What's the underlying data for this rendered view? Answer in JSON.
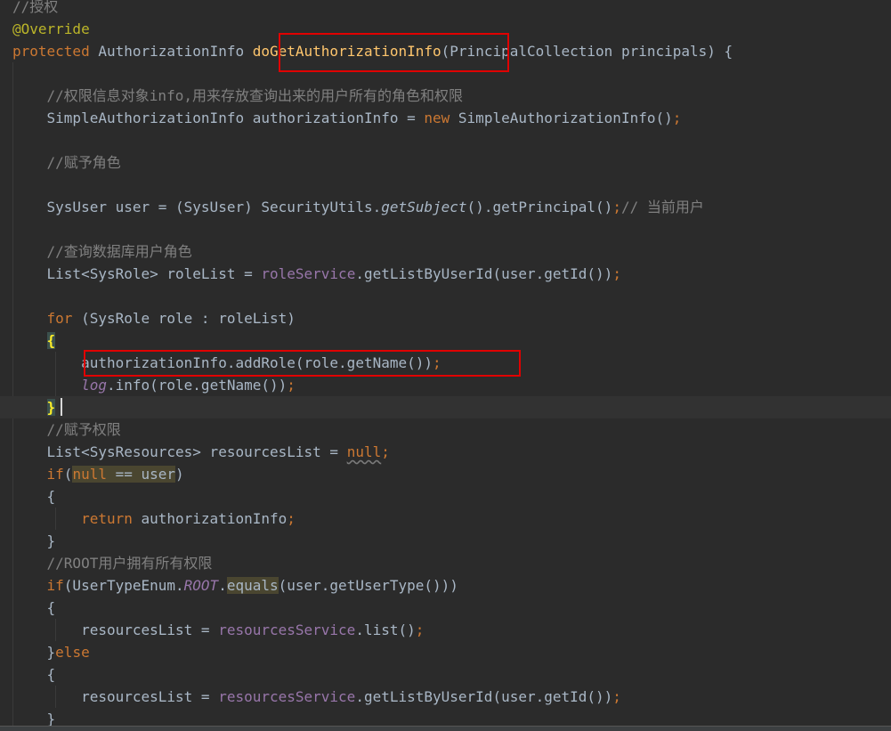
{
  "lines": [
    {
      "tokens": [
        {
          "t": "//授权",
          "c": "comment"
        }
      ]
    },
    {
      "tokens": [
        {
          "t": "@Override",
          "c": "annotation"
        }
      ]
    },
    {
      "tokens": [
        {
          "t": "protected",
          "c": "keyword"
        },
        {
          "t": " AuthorizationInfo ",
          "c": "plain"
        },
        {
          "t": "doGetAuthorizationInfo",
          "c": "method-decl"
        },
        {
          "t": "(PrincipalCollection principals) {",
          "c": "plain"
        }
      ]
    },
    {
      "tokens": []
    },
    {
      "tokens": [
        {
          "t": "    //权限信息对象info,用来存放查询出来的用户所有的角色和权限",
          "c": "comment"
        }
      ]
    },
    {
      "tokens": [
        {
          "t": "    SimpleAuthorizationInfo authorizationInfo = ",
          "c": "plain"
        },
        {
          "t": "new",
          "c": "keyword"
        },
        {
          "t": " SimpleAuthorizationInfo()",
          "c": "plain"
        },
        {
          "t": ";",
          "c": "punct"
        }
      ]
    },
    {
      "tokens": []
    },
    {
      "tokens": [
        {
          "t": "    //赋予角色",
          "c": "comment"
        }
      ]
    },
    {
      "tokens": []
    },
    {
      "tokens": [
        {
          "t": "    SysUser user = (SysUser) SecurityUtils.",
          "c": "plain"
        },
        {
          "t": "getSubject",
          "c": "italic-call"
        },
        {
          "t": "().getPrincipal()",
          "c": "plain"
        },
        {
          "t": ";",
          "c": "punct"
        },
        {
          "t": "// 当前用户",
          "c": "comment"
        }
      ]
    },
    {
      "tokens": []
    },
    {
      "tokens": [
        {
          "t": "    //查询数据库用户角色",
          "c": "comment"
        }
      ]
    },
    {
      "tokens": [
        {
          "t": "    List<SysRole> roleList = ",
          "c": "plain"
        },
        {
          "t": "roleService",
          "c": "field"
        },
        {
          "t": ".getListByUserId(user.getId())",
          "c": "plain"
        },
        {
          "t": ";",
          "c": "punct"
        }
      ]
    },
    {
      "tokens": []
    },
    {
      "tokens": [
        {
          "t": "    ",
          "c": "plain"
        },
        {
          "t": "for",
          "c": "keyword"
        },
        {
          "t": " (SysRole role : roleList)",
          "c": "plain"
        }
      ]
    },
    {
      "tokens": [
        {
          "t": "    ",
          "c": "plain"
        },
        {
          "t": "{",
          "c": "brace-hl"
        }
      ]
    },
    {
      "tokens": [
        {
          "t": "        authorizationInfo.addRole(role.getName())",
          "c": "plain"
        },
        {
          "t": ";",
          "c": "punct"
        }
      ]
    },
    {
      "tokens": [
        {
          "t": "        ",
          "c": "plain"
        },
        {
          "t": "log",
          "c": "static"
        },
        {
          "t": ".info(role.getName())",
          "c": "plain"
        },
        {
          "t": ";",
          "c": "punct"
        }
      ]
    },
    {
      "tokens": [
        {
          "t": "    ",
          "c": "plain"
        },
        {
          "t": "}",
          "c": "brace-hl"
        }
      ],
      "current": true
    },
    {
      "tokens": [
        {
          "t": "    //赋予权限",
          "c": "comment"
        }
      ]
    },
    {
      "tokens": [
        {
          "t": "    List<SysResources> resourcesList = ",
          "c": "plain"
        },
        {
          "t": "null",
          "c": "keyword wavy"
        },
        {
          "t": ";",
          "c": "punct"
        }
      ]
    },
    {
      "tokens": [
        {
          "t": "    ",
          "c": "plain"
        },
        {
          "t": "if",
          "c": "keyword"
        },
        {
          "t": "(",
          "c": "plain"
        },
        {
          "t": "null",
          "c": "keyword hl"
        },
        {
          "t": " == user",
          "c": "plain hl"
        },
        {
          "t": ")",
          "c": "plain"
        }
      ]
    },
    {
      "tokens": [
        {
          "t": "    {",
          "c": "plain"
        }
      ]
    },
    {
      "tokens": [
        {
          "t": "        ",
          "c": "plain"
        },
        {
          "t": "return",
          "c": "keyword"
        },
        {
          "t": " authorizationInfo",
          "c": "plain"
        },
        {
          "t": ";",
          "c": "punct"
        }
      ]
    },
    {
      "tokens": [
        {
          "t": "    }",
          "c": "plain"
        }
      ]
    },
    {
      "tokens": [
        {
          "t": "    //ROOT用户拥有所有权限",
          "c": "comment"
        }
      ]
    },
    {
      "tokens": [
        {
          "t": "    ",
          "c": "plain"
        },
        {
          "t": "if",
          "c": "keyword"
        },
        {
          "t": "(UserTypeEnum.",
          "c": "plain"
        },
        {
          "t": "ROOT",
          "c": "static"
        },
        {
          "t": ".",
          "c": "plain"
        },
        {
          "t": "equals",
          "c": "plain hl"
        },
        {
          "t": "(user.getUserType()))",
          "c": "plain"
        }
      ]
    },
    {
      "tokens": [
        {
          "t": "    {",
          "c": "plain"
        }
      ]
    },
    {
      "tokens": [
        {
          "t": "        resourcesList = ",
          "c": "plain"
        },
        {
          "t": "resourcesService",
          "c": "field"
        },
        {
          "t": ".list()",
          "c": "plain"
        },
        {
          "t": ";",
          "c": "punct"
        }
      ]
    },
    {
      "tokens": [
        {
          "t": "    }",
          "c": "plain"
        },
        {
          "t": "else",
          "c": "keyword"
        }
      ]
    },
    {
      "tokens": [
        {
          "t": "    {",
          "c": "plain"
        }
      ]
    },
    {
      "tokens": [
        {
          "t": "        resourcesList = ",
          "c": "plain"
        },
        {
          "t": "resourcesService",
          "c": "field"
        },
        {
          "t": ".getListByUserId(user.getId())",
          "c": "plain"
        },
        {
          "t": ";",
          "c": "punct"
        }
      ]
    },
    {
      "tokens": [
        {
          "t": "    }",
          "c": "plain"
        }
      ]
    }
  ]
}
